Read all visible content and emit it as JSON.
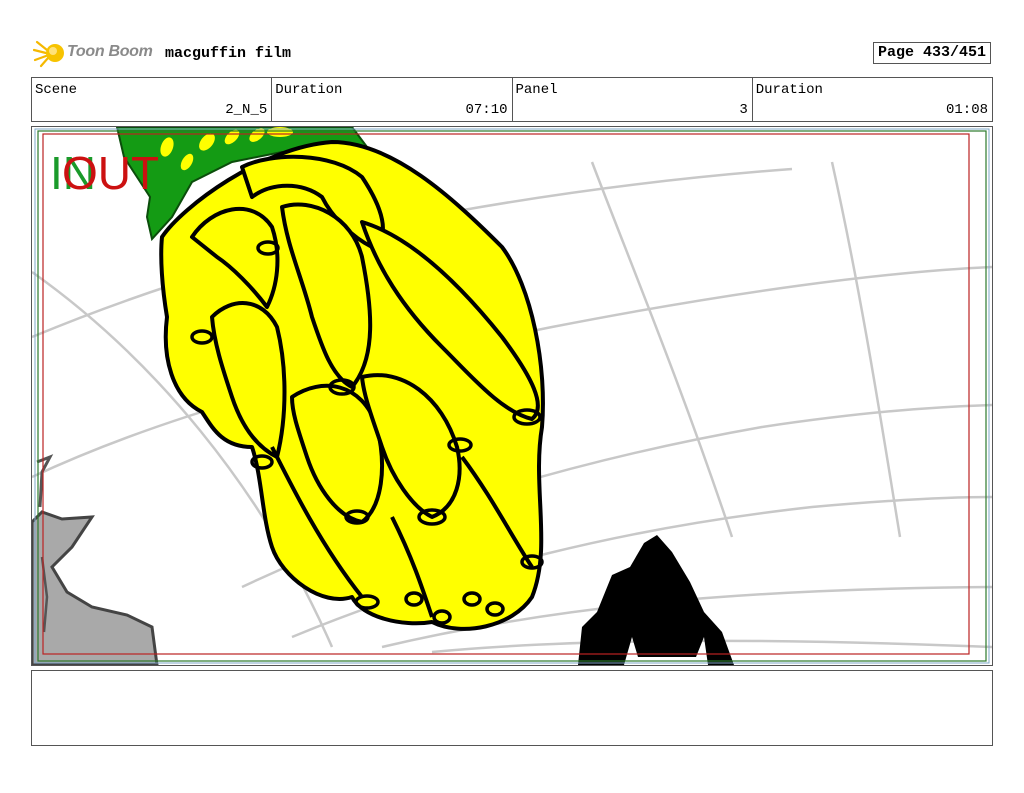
{
  "header": {
    "logo_text": "Toon Boom",
    "project_title": "macguffin film",
    "page_label": "Page 433/451"
  },
  "info": {
    "scene_label": "Scene",
    "scene_value": "2_N_5",
    "duration_label": "Duration",
    "duration_value": "07:10",
    "panel_label": "Panel",
    "panel_value": "3",
    "panel_duration_label": "Duration",
    "panel_duration_value": "01:08"
  },
  "panel_art": {
    "in_mark": "IN",
    "out_mark": "OUT",
    "colors": {
      "banana": "#ffff00",
      "leaves": "#149b14",
      "guide_lines": "#c8c8c8",
      "rock": "#a9a9a9",
      "in_mark": "#1a9a2a",
      "out_mark": "#cc1111"
    }
  },
  "notes": {
    "text": ""
  }
}
